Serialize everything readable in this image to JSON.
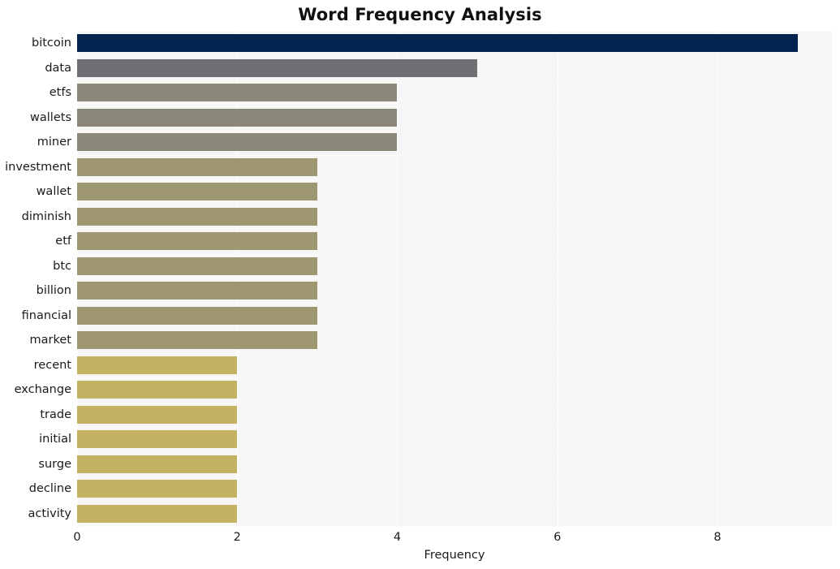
{
  "chart_data": {
    "type": "bar",
    "orientation": "horizontal",
    "title": "Word Frequency Analysis",
    "xlabel": "Frequency",
    "ylabel": "",
    "xlim": [
      0,
      9.43
    ],
    "xticks": [
      0,
      2,
      4,
      6,
      8
    ],
    "xtick_labels": [
      "0",
      "2",
      "4",
      "6",
      "8"
    ],
    "grid": true,
    "grid_axis": "both",
    "legend": "none",
    "plot_background": "#f6f6f7",
    "figure_background": "#ffffff",
    "categories": [
      "bitcoin",
      "data",
      "etfs",
      "wallets",
      "miner",
      "investment",
      "wallet",
      "diminish",
      "etf",
      "btc",
      "billion",
      "financial",
      "market",
      "recent",
      "exchange",
      "trade",
      "initial",
      "surge",
      "decline",
      "activity"
    ],
    "values": [
      9,
      5,
      4,
      4,
      4,
      3,
      3,
      3,
      3,
      3,
      3,
      3,
      3,
      2,
      2,
      2,
      2,
      2,
      2,
      2
    ],
    "bar_colors": [
      "#042350",
      "#6f7074",
      "#8b8879",
      "#8b8879",
      "#8b8879",
      "#9e9770",
      "#9e9770",
      "#9e9770",
      "#9e9770",
      "#9e9770",
      "#9e9770",
      "#9e9770",
      "#9e9770",
      "#c2b261",
      "#c2b261",
      "#c2b261",
      "#c2b261",
      "#c2b261",
      "#c2b261",
      "#c2b261"
    ]
  }
}
